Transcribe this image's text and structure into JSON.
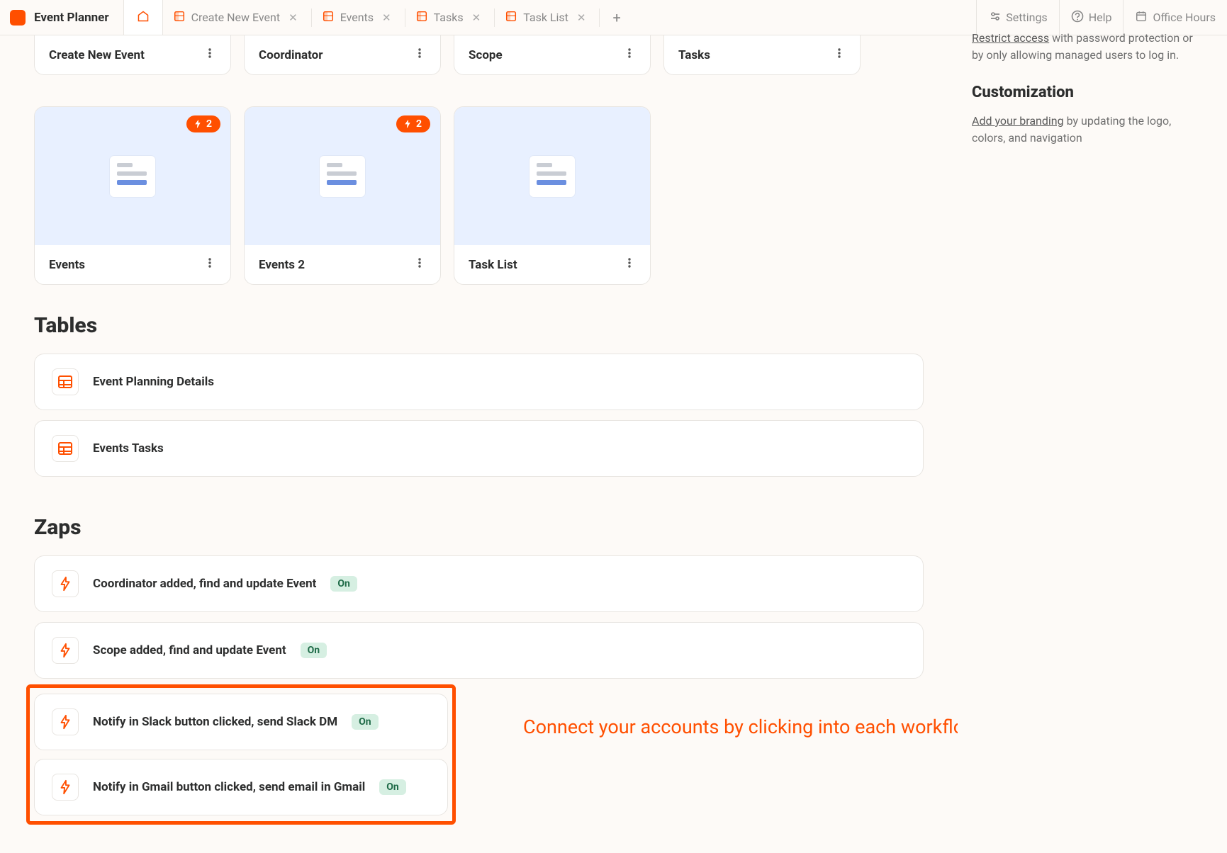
{
  "brand": {
    "title": "Event Planner"
  },
  "tabs": [
    {
      "label": "Create New Event"
    },
    {
      "label": "Events"
    },
    {
      "label": "Tasks"
    },
    {
      "label": "Task List"
    }
  ],
  "topbar_right": {
    "settings": "Settings",
    "help": "Help",
    "office_hours": "Office Hours"
  },
  "cut_cards": [
    {
      "title": "Create New Event"
    },
    {
      "title": "Coordinator"
    },
    {
      "title": "Scope"
    },
    {
      "title": "Tasks"
    }
  ],
  "preview_cards": [
    {
      "title": "Events",
      "badge": "2"
    },
    {
      "title": "Events 2",
      "badge": "2"
    },
    {
      "title": "Task List",
      "badge": null
    }
  ],
  "sections": {
    "tables": {
      "heading": "Tables",
      "items": [
        {
          "title": "Event Planning Details"
        },
        {
          "title": "Events Tasks"
        }
      ]
    },
    "zaps": {
      "heading": "Zaps",
      "items_a": [
        {
          "title": "Coordinator added, find and update Event",
          "status": "On"
        },
        {
          "title": "Scope added, find and update Event",
          "status": "On"
        }
      ],
      "items_b": [
        {
          "title": "Notify in Slack button clicked, send Slack DM",
          "status": "On"
        },
        {
          "title": "Notify in Gmail button clicked, send email in Gmail",
          "status": "On"
        }
      ]
    }
  },
  "annotation": "Connect your accounts by clicking into each workflow here",
  "rside": {
    "cut_para_link": "Restrict access",
    "cut_para_rest": " with password protection or by only allowing managed users to log in.",
    "custom_heading": "Customization",
    "custom_link": "Add your branding",
    "custom_rest": " by updating the logo, colors, and navigation"
  }
}
